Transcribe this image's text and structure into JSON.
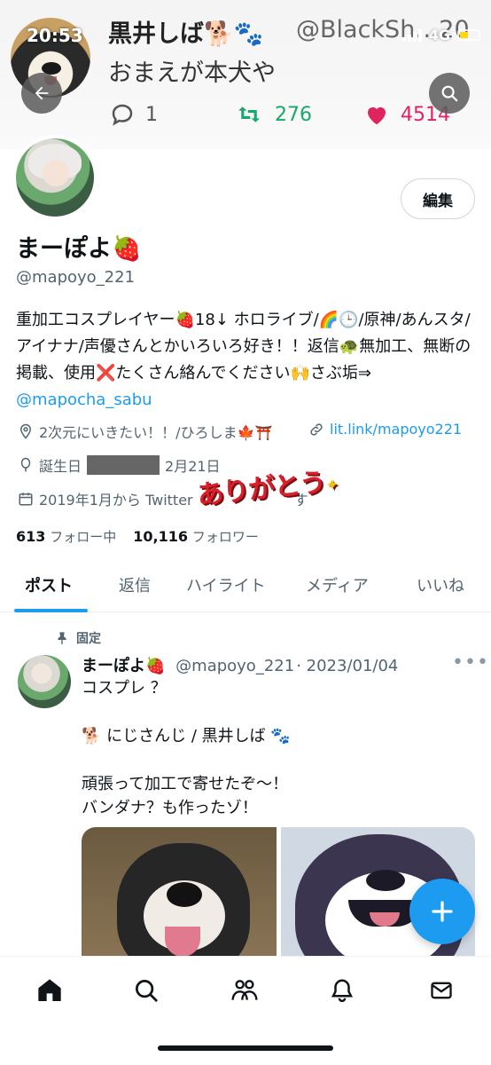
{
  "status_bar": {
    "time": "20:53",
    "network": "4G"
  },
  "banner_tweet": {
    "name": "黒井しば🐕🐾",
    "handle": "@BlackSh…20",
    "text": "おまえが本犬や",
    "replies": "1",
    "retweets": "276",
    "likes": "4514"
  },
  "profile": {
    "edit_label": "編集",
    "display_name": "まーぽよ🍓",
    "username": "@mapoyo_221",
    "bio_text": "重加工コスプレイヤー🍓18↓ ホロライブ/🌈🕒/原神/あんスタ/アイナナ/声優さんとかいろいろ好き！！返信🐢無加工、無断の掲載、使用❌たくさん絡んでください🙌さぶ垢⇒ ",
    "bio_link": "@mapocha_sabu",
    "location": "2次元にいきたい！！/ひろしま🍁⛩️",
    "website": "lit.link/mapoyo221",
    "birthday_prefix": "誕生日",
    "birthday_suffix": "2月21日",
    "joined_prefix": "2019年1月から Twitter",
    "joined_suffix": "す",
    "stamp_text": "ありがとう",
    "following_count": "613",
    "following_label": "フォロー中",
    "followers_count": "10,116",
    "followers_label": "フォロワー"
  },
  "tabs": [
    "ポスト",
    "返信",
    "ハイライト",
    "メディア",
    "いいね"
  ],
  "pinned_tweet": {
    "pinned_label": "固定",
    "name": "まーぽよ🍓",
    "handle": "@mapoyo_221",
    "date": "· 2023/01/04",
    "text": "コスプレ ？\n\n🐕 にじさんじ / 黒井しば 🐾\n\n頑張って加工で寄せたぞ〜！\nバンダナ？も作ったゾ！"
  },
  "colors": {
    "accent": "#1d9bf0",
    "retweet": "#17a86b",
    "like": "#e0245e",
    "stamp": "#d91f2a"
  },
  "icons": [
    "back-icon",
    "search-icon",
    "reply-icon",
    "retweet-icon",
    "heart-icon",
    "location-icon",
    "link-icon",
    "balloon-icon",
    "calendar-icon",
    "pin-icon",
    "plus-icon",
    "home-icon",
    "communities-icon",
    "bell-icon",
    "mail-icon"
  ]
}
